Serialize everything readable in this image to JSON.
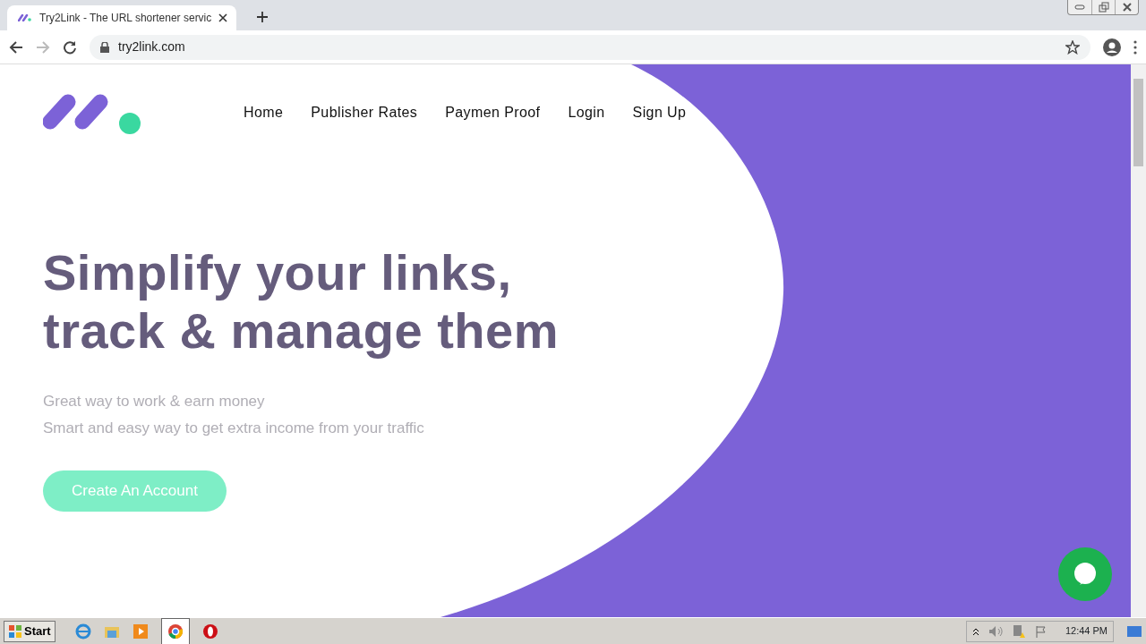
{
  "browser": {
    "tab_title": "Try2Link - The URL shortener servic",
    "url": "try2link.com"
  },
  "nav": [
    {
      "label": "Home"
    },
    {
      "label": "Publisher Rates"
    },
    {
      "label": "Paymen Proof"
    },
    {
      "label": "Login"
    },
    {
      "label": "Sign Up"
    }
  ],
  "hero": {
    "heading_lines": [
      "Simplify your links,",
      "track & manage them"
    ],
    "subtitle_lines": [
      "Great way to work & earn money",
      "Smart and easy way to get extra income from your traffic"
    ],
    "cta": "Create An Account"
  },
  "taskbar": {
    "start": "Start",
    "clock": "12:44 PM"
  }
}
